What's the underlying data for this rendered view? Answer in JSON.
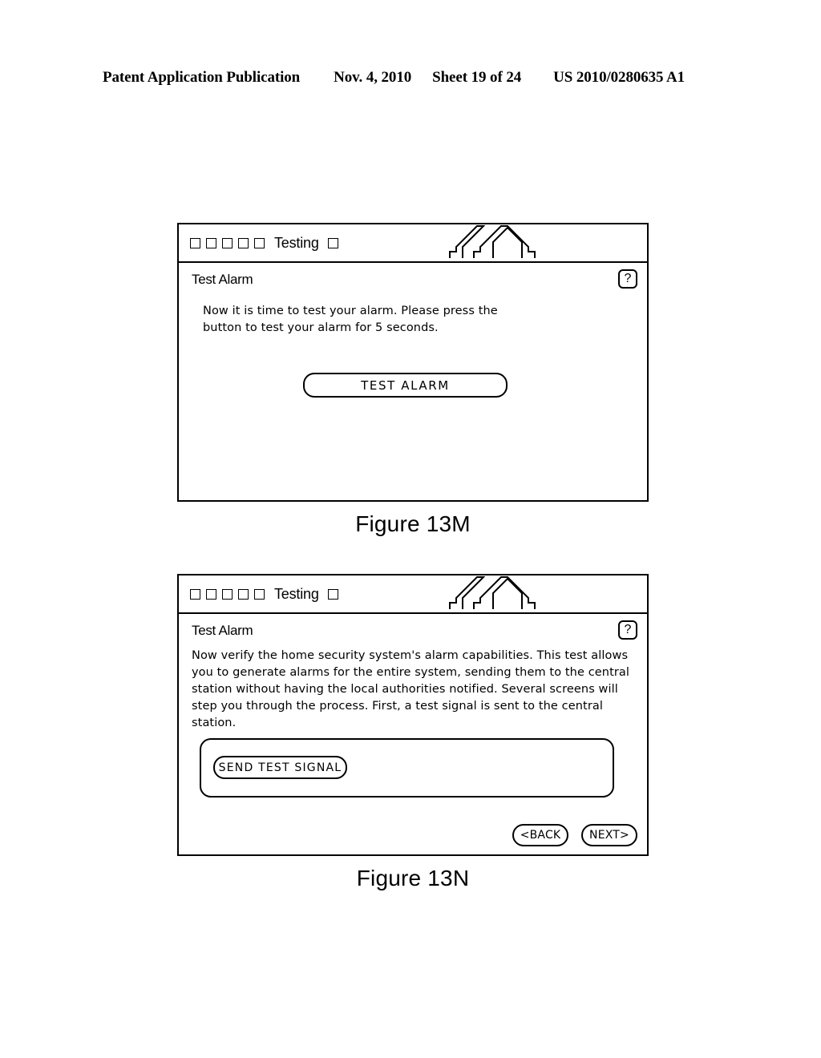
{
  "page_header": {
    "publication": "Patent Application Publication",
    "date": "Nov. 4, 2010",
    "sheet": "Sheet 19 of 24",
    "patent_number": "US 2010/0280635 A1"
  },
  "figures": [
    {
      "id": "13M",
      "caption": "Figure 13M",
      "statusbar": {
        "checkbox_count_left": 5,
        "label": "Testing",
        "checkbox_count_right": 1,
        "logo_name": "house-roof-logo"
      },
      "screen": {
        "title": "Test Alarm",
        "help_label": "?",
        "body": "Now it is time to test your alarm. Please press the\nbutton to test your alarm for 5 seconds.",
        "primary_button": "TEST ALARM"
      }
    },
    {
      "id": "13N",
      "caption": "Figure 13N",
      "statusbar": {
        "checkbox_count_left": 5,
        "label": "Testing",
        "checkbox_count_right": 1,
        "logo_name": "house-roof-logo"
      },
      "screen": {
        "title": "Test Alarm",
        "help_label": "?",
        "body": "Now verify the home security system's alarm capabilities. This test allows you to generate alarms for the entire system, sending them to the central station without having the local authorities notified. Several screens will step you through the process. First, a test signal is sent to the central station.",
        "signal_button": "SEND  TEST  SIGNAL",
        "back_button": "<BACK",
        "next_button": "NEXT>"
      }
    }
  ],
  "colors": {
    "ink": "#000000",
    "paper": "#ffffff"
  }
}
